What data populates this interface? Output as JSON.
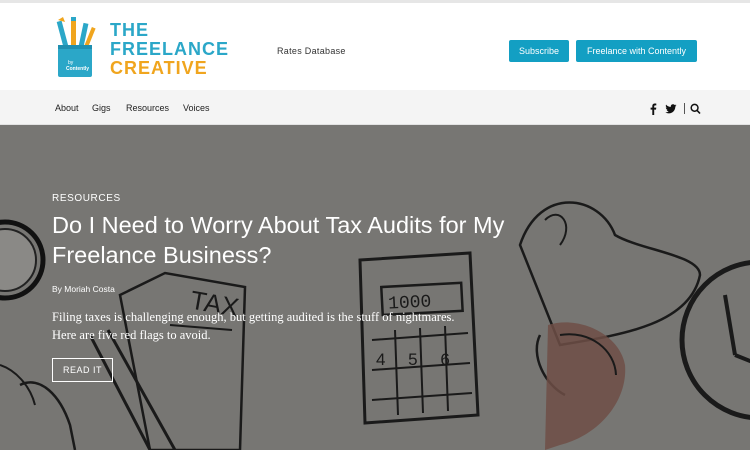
{
  "brand": {
    "line1": "THE",
    "line2": "FREELANCE",
    "line3": "CREATIVE",
    "badge": "by Contently",
    "primary_color": "#2ba7c8",
    "accent_color": "#f0a51e"
  },
  "header": {
    "rates_link": "Rates Database",
    "subscribe_label": "Subscribe",
    "freelance_label": "Freelance with Contently"
  },
  "nav": {
    "items": [
      "About",
      "Gigs",
      "Resources",
      "Voices"
    ],
    "icons": [
      "facebook-icon",
      "twitter-icon",
      "search-icon"
    ]
  },
  "hero": {
    "category": "RESOURCES",
    "title": "Do I Need to Worry About Tax Audits for My Freelance Business?",
    "author": "By Moriah Costa",
    "excerpt": "Filing taxes is challenging enough, but getting audited is the stuff of nightmares. Here are five red flags to avoid.",
    "cta": "READ IT",
    "illustration_text": {
      "tax_label": "TAX",
      "calculator_display": "1000",
      "calculator_keys": "4 5 6"
    }
  }
}
